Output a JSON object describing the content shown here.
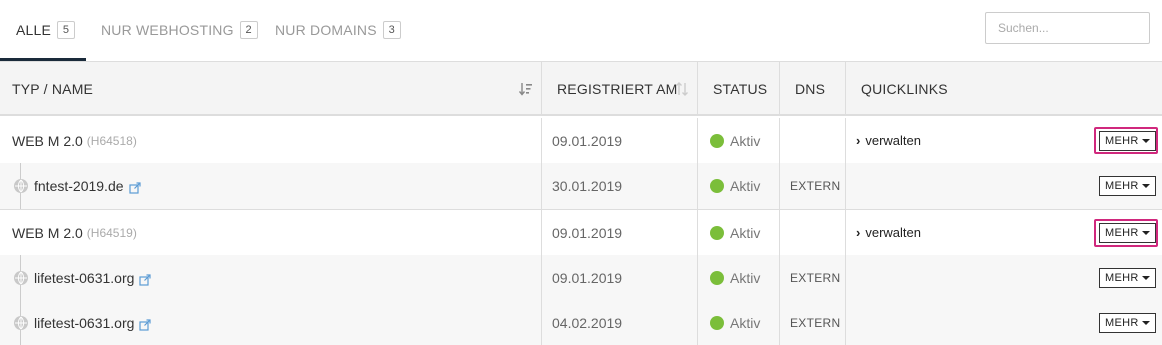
{
  "tabs": [
    {
      "label": "ALLE",
      "count": "5"
    },
    {
      "label": "NUR WEBHOSTING",
      "count": "2"
    },
    {
      "label": "NUR DOMAINS",
      "count": "3"
    }
  ],
  "search": {
    "placeholder": "Suchen..."
  },
  "headers": {
    "typ_name": "TYP / NAME",
    "registriert": "REGISTRIERT AM",
    "status": "STATUS",
    "dns": "DNS",
    "quicklinks": "QUICKLINKS"
  },
  "rows": [
    {
      "name": "WEB M 2.0",
      "sub": "(H64518)",
      "date": "09.01.2019",
      "status": "Aktiv",
      "dns": "",
      "quicklink": "verwalten",
      "action": "MEHR"
    },
    {
      "name": "fntest-2019.de",
      "sub": "",
      "date": "30.01.2019",
      "status": "Aktiv",
      "dns": "EXTERN",
      "quicklink": "",
      "action": "MEHR"
    },
    {
      "name": "WEB M 2.0",
      "sub": "(H64519)",
      "date": "09.01.2019",
      "status": "Aktiv",
      "dns": "",
      "quicklink": "verwalten",
      "action": "MEHR"
    },
    {
      "name": "lifetest-0631.org",
      "sub": "",
      "date": "09.01.2019",
      "status": "Aktiv",
      "dns": "EXTERN",
      "quicklink": "",
      "action": "MEHR"
    },
    {
      "name": "lifetest-0631.org",
      "sub": "",
      "date": "04.02.2019",
      "status": "Aktiv",
      "dns": "EXTERN",
      "quicklink": "",
      "action": "MEHR"
    }
  ],
  "colors": {
    "accent": "#d0287d",
    "status_active": "#7bbe3a",
    "tab_underline": "#1a2a3a"
  },
  "icons": [
    "sort-desc-icon",
    "sort-icon",
    "globe-icon",
    "external-link-icon",
    "chevron-right-icon",
    "caret-down-icon"
  ]
}
